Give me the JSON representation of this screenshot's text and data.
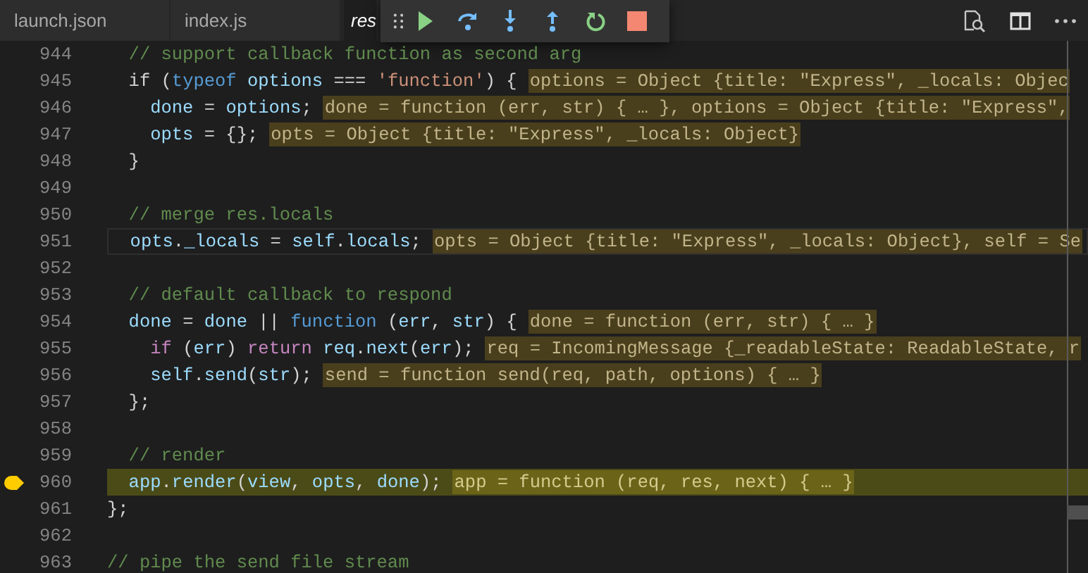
{
  "tabs": [
    {
      "label": "launch.json",
      "selected": false,
      "preview": false
    },
    {
      "label": "index.js",
      "selected": false,
      "preview": false
    },
    {
      "label": "res",
      "selected": true,
      "preview": true
    }
  ],
  "debug_toolbar": [
    {
      "kind": "grip"
    },
    {
      "kind": "continue"
    },
    {
      "kind": "step-over"
    },
    {
      "kind": "step-into"
    },
    {
      "kind": "step-out"
    },
    {
      "kind": "restart"
    },
    {
      "kind": "stop"
    }
  ],
  "editor_actions": [
    {
      "kind": "find"
    },
    {
      "kind": "split"
    },
    {
      "kind": "more"
    }
  ],
  "lines": [
    {
      "number": "944",
      "breakpoint": false,
      "current": false,
      "focused": false,
      "segments": [
        {
          "text": "  // support callback function as second arg",
          "kind": "comment"
        }
      ]
    },
    {
      "number": "945",
      "breakpoint": false,
      "current": false,
      "focused": false,
      "segments": [
        {
          "text": "  if (",
          "kind": "plain"
        },
        {
          "text": "typeof",
          "kind": "keyword"
        },
        {
          "text": " options",
          "kind": "variable"
        },
        {
          "text": " === ",
          "kind": "plain"
        },
        {
          "text": "'function'",
          "kind": "string"
        },
        {
          "text": ") {",
          "kind": "plain"
        }
      ],
      "inline_value": "options = Object {title: \"Express\", _locals: Objec"
    },
    {
      "number": "946",
      "breakpoint": false,
      "current": false,
      "focused": false,
      "segments": [
        {
          "text": "    done",
          "kind": "variable"
        },
        {
          "text": " = ",
          "kind": "plain"
        },
        {
          "text": "options",
          "kind": "variable"
        },
        {
          "text": ";",
          "kind": "plain"
        }
      ],
      "inline_value": "done = function (err, str) { … }, options = Object {title: \"Express\","
    },
    {
      "number": "947",
      "breakpoint": false,
      "current": false,
      "focused": false,
      "segments": [
        {
          "text": "    opts",
          "kind": "variable"
        },
        {
          "text": " = {};",
          "kind": "plain"
        }
      ],
      "inline_value": "opts = Object {title: \"Express\", _locals: Object}"
    },
    {
      "number": "948",
      "breakpoint": false,
      "current": false,
      "focused": false,
      "segments": [
        {
          "text": "  }",
          "kind": "plain"
        }
      ]
    },
    {
      "number": "949",
      "breakpoint": false,
      "current": false,
      "focused": false
    },
    {
      "number": "950",
      "breakpoint": false,
      "current": false,
      "focused": false,
      "segments": [
        {
          "text": "  // merge res.locals",
          "kind": "comment"
        }
      ]
    },
    {
      "number": "951",
      "breakpoint": false,
      "current": false,
      "focused": true,
      "segments": [
        {
          "text": "  opts",
          "kind": "variable"
        },
        {
          "text": ".",
          "kind": "plain"
        },
        {
          "text": "_locals",
          "kind": "variable"
        },
        {
          "text": " = ",
          "kind": "plain"
        },
        {
          "text": "self",
          "kind": "variable"
        },
        {
          "text": ".",
          "kind": "plain"
        },
        {
          "text": "locals",
          "kind": "variable"
        },
        {
          "text": ";",
          "kind": "plain"
        }
      ],
      "inline_value": "opts = Object {title: \"Express\", _locals: Object}, self = Se"
    },
    {
      "number": "952",
      "breakpoint": false,
      "current": false,
      "focused": false
    },
    {
      "number": "953",
      "breakpoint": false,
      "current": false,
      "focused": false,
      "segments": [
        {
          "text": "  // default callback to respond",
          "kind": "comment"
        }
      ]
    },
    {
      "number": "954",
      "breakpoint": false,
      "current": false,
      "focused": false,
      "segments": [
        {
          "text": "  done",
          "kind": "variable"
        },
        {
          "text": " = ",
          "kind": "plain"
        },
        {
          "text": "done",
          "kind": "variable"
        },
        {
          "text": " || ",
          "kind": "plain"
        },
        {
          "text": "function",
          "kind": "keyword"
        },
        {
          "text": " (",
          "kind": "plain"
        },
        {
          "text": "err",
          "kind": "variable"
        },
        {
          "text": ", ",
          "kind": "plain"
        },
        {
          "text": "str",
          "kind": "variable"
        },
        {
          "text": ") {",
          "kind": "plain"
        }
      ],
      "inline_value": "done = function (err, str) { … }"
    },
    {
      "number": "955",
      "breakpoint": false,
      "current": false,
      "focused": false,
      "segments": [
        {
          "text": "    if",
          "kind": "control"
        },
        {
          "text": " (",
          "kind": "plain"
        },
        {
          "text": "err",
          "kind": "variable"
        },
        {
          "text": ") ",
          "kind": "plain"
        },
        {
          "text": "return",
          "kind": "control"
        },
        {
          "text": " req",
          "kind": "variable"
        },
        {
          "text": ".",
          "kind": "plain"
        },
        {
          "text": "next",
          "kind": "variable"
        },
        {
          "text": "(",
          "kind": "plain"
        },
        {
          "text": "err",
          "kind": "variable"
        },
        {
          "text": ");",
          "kind": "plain"
        }
      ],
      "inline_value": "req = IncomingMessage {_readableState: ReadableState, r"
    },
    {
      "number": "956",
      "breakpoint": false,
      "current": false,
      "focused": false,
      "segments": [
        {
          "text": "    self",
          "kind": "variable"
        },
        {
          "text": ".",
          "kind": "plain"
        },
        {
          "text": "send",
          "kind": "variable"
        },
        {
          "text": "(",
          "kind": "plain"
        },
        {
          "text": "str",
          "kind": "variable"
        },
        {
          "text": ");",
          "kind": "plain"
        }
      ],
      "inline_value": "send = function send(req, path, options) { … }"
    },
    {
      "number": "957",
      "breakpoint": false,
      "current": false,
      "focused": false,
      "segments": [
        {
          "text": "  };",
          "kind": "plain"
        }
      ]
    },
    {
      "number": "958",
      "breakpoint": false,
      "current": false,
      "focused": false
    },
    {
      "number": "959",
      "breakpoint": false,
      "current": false,
      "focused": false,
      "segments": [
        {
          "text": "  // render",
          "kind": "comment"
        }
      ]
    },
    {
      "number": "960",
      "breakpoint": true,
      "current": true,
      "focused": false,
      "segments": [
        {
          "text": "  app",
          "kind": "variable"
        },
        {
          "text": ".",
          "kind": "plain"
        },
        {
          "text": "render",
          "kind": "variable"
        },
        {
          "text": "(",
          "kind": "plain"
        },
        {
          "text": "view",
          "kind": "variable"
        },
        {
          "text": ", ",
          "kind": "plain"
        },
        {
          "text": "opts",
          "kind": "variable"
        },
        {
          "text": ", ",
          "kind": "plain"
        },
        {
          "text": "done",
          "kind": "variable"
        },
        {
          "text": ");",
          "kind": "plain"
        }
      ],
      "inline_value": "app = function (req, res, next) { … }"
    },
    {
      "number": "961",
      "breakpoint": false,
      "current": false,
      "focused": false,
      "segments": [
        {
          "text": "};",
          "kind": "plain"
        }
      ]
    },
    {
      "number": "962",
      "breakpoint": false,
      "current": false,
      "focused": false
    },
    {
      "number": "963",
      "breakpoint": false,
      "current": false,
      "focused": false,
      "segments": [
        {
          "text": "// pipe the send file stream",
          "kind": "comment"
        }
      ]
    }
  ]
}
